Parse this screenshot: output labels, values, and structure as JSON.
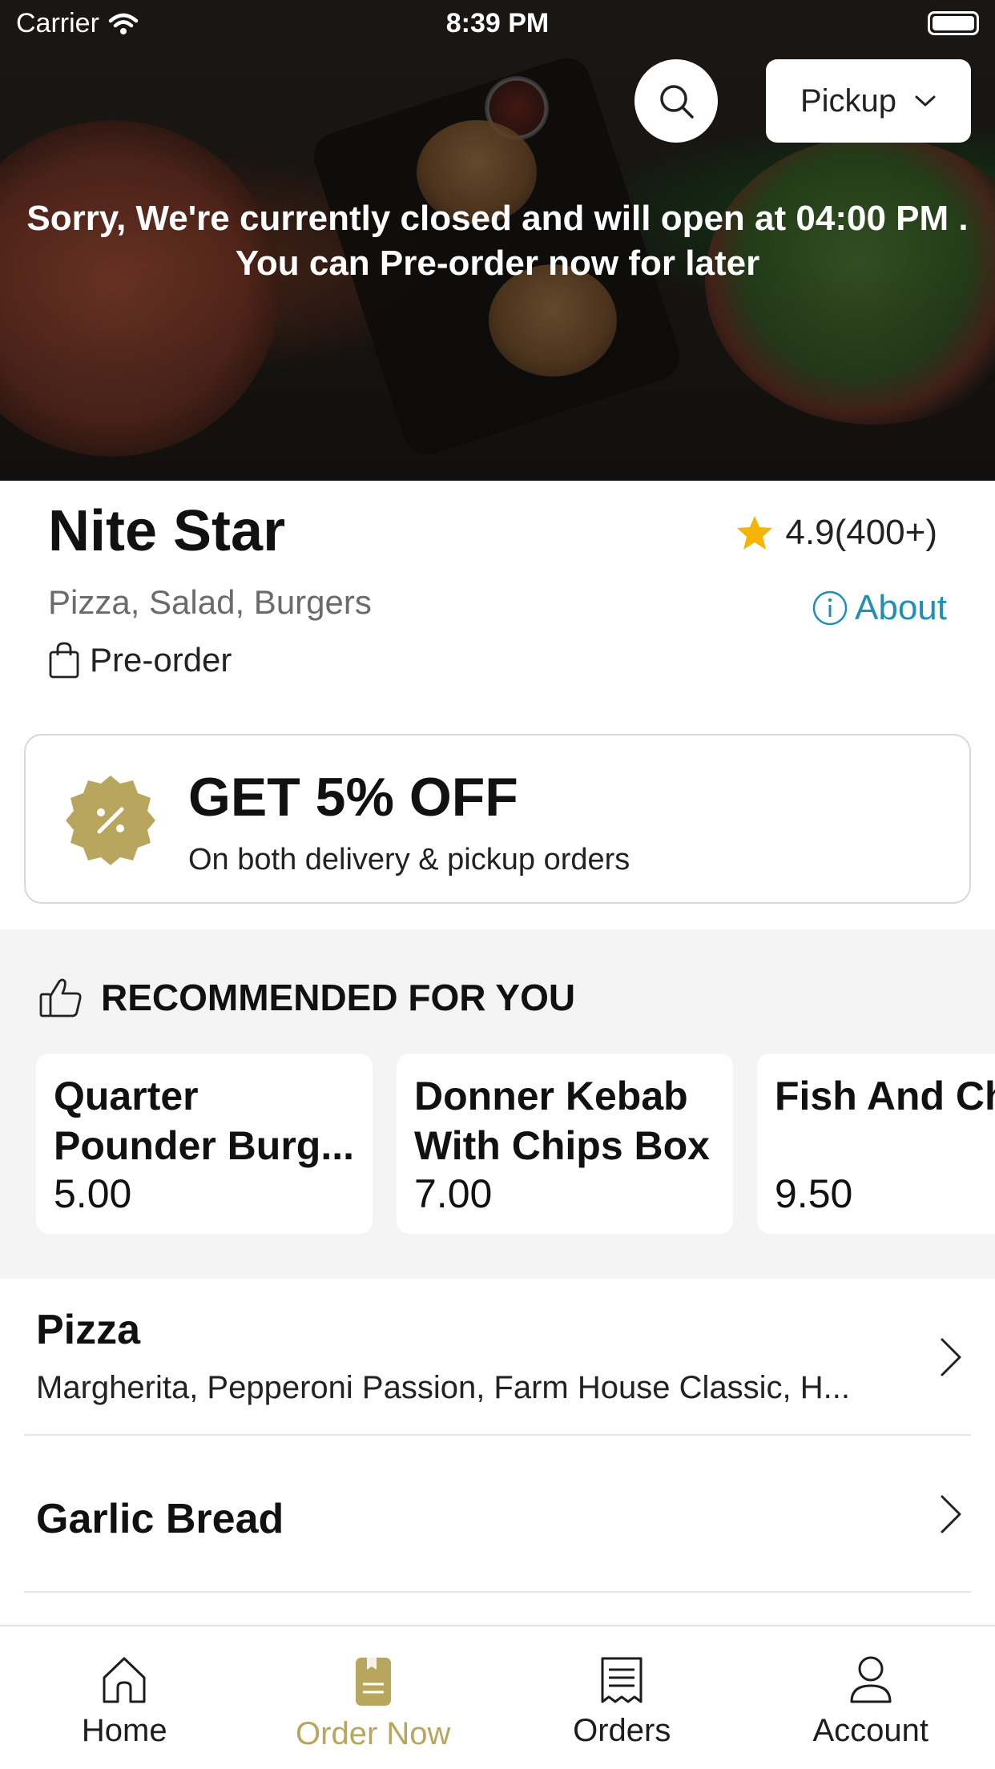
{
  "status_bar": {
    "carrier": "Carrier",
    "time": "8:39 PM"
  },
  "hero": {
    "order_mode": "Pickup",
    "closed_message_line1": "Sorry, We're currently closed and will open at 04:00 PM .",
    "closed_message_line2": "You can Pre-order now for later"
  },
  "restaurant": {
    "name": "Nite Star",
    "rating": "4.9(400+)",
    "cuisines": "Pizza, Salad, Burgers",
    "about_label": "About",
    "order_type": "Pre-order"
  },
  "offer": {
    "title": "GET 5% OFF",
    "subtitle": "On both delivery & pickup orders"
  },
  "recommended": {
    "heading": "RECOMMENDED FOR YOU",
    "items": [
      {
        "name": "Quarter Pounder Burg...",
        "price": "5.00"
      },
      {
        "name": "Donner Kebab With Chips Box",
        "price": "7.00"
      },
      {
        "name": "Fish And Chips",
        "price": "9.50"
      }
    ]
  },
  "categories": [
    {
      "title": "Pizza",
      "items": "Margherita, Pepperoni Passion, Farm House Classic, H..."
    },
    {
      "title": "Garlic Bread",
      "items": ""
    }
  ],
  "tabbar": {
    "tabs": [
      {
        "label": "Home",
        "icon": "home-icon"
      },
      {
        "label": "Order Now",
        "icon": "order-icon"
      },
      {
        "label": "Orders",
        "icon": "receipt-icon"
      },
      {
        "label": "Account",
        "icon": "user-icon"
      }
    ],
    "active": "Order Now"
  },
  "colors": {
    "accent": "#b8a55e",
    "link": "#1f8fb5",
    "star": "#f4b400"
  }
}
